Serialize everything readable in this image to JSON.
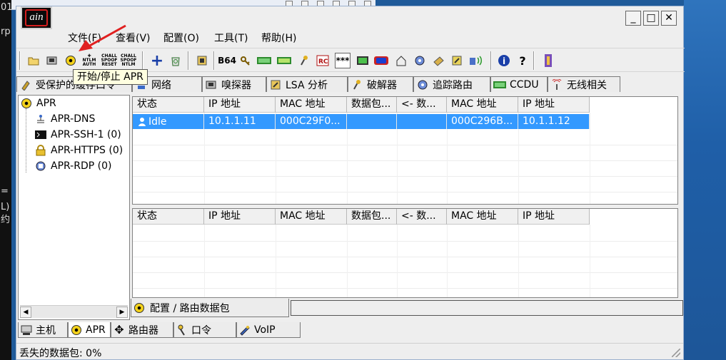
{
  "desktop": {
    "left_glyphs": [
      "01",
      "rp",
      "",
      "",
      "",
      "",
      "",
      "",
      "",
      "",
      "",
      "=",
      "L)",
      "约"
    ]
  },
  "window": {
    "logo_text": "ain",
    "minimize": "_",
    "maximize": "□",
    "close": "✕"
  },
  "menu": {
    "file": "文件(F)",
    "view": "查看(V)",
    "config": "配置(O)",
    "tools": "工具(T)",
    "help": "帮助(H)"
  },
  "toolbar": {
    "tooltip": "开始/停止 APR",
    "b64": "B64",
    "ntlm_auth": "NTLM AUTH",
    "chall_spoof_reset": "CHALL SPOOF RESET",
    "chall_spoof_ntlm": "CHALL SPOOF NTLM",
    "pwd": "***"
  },
  "tabs": [
    {
      "label": "受保护的缓存口令"
    },
    {
      "label": "网络"
    },
    {
      "label": "嗅探器"
    },
    {
      "label": "LSA 分析"
    },
    {
      "label": "破解器"
    },
    {
      "label": "追踪路由"
    },
    {
      "label": "CCDU"
    },
    {
      "label": "无线相关"
    }
  ],
  "tree": {
    "root": "APR",
    "children": [
      "APR-DNS",
      "APR-SSH-1 (0)",
      "APR-HTTPS (0)",
      "APR-RDP (0)"
    ]
  },
  "grid_top": {
    "columns": [
      "状态",
      "IP 地址",
      "MAC 地址",
      "数据包...",
      "<- 数...",
      "MAC 地址",
      "IP 地址"
    ],
    "rows": [
      [
        "Idle",
        "10.1.1.11",
        "000C29F0...",
        "",
        "",
        "000C296B...",
        "10.1.1.12"
      ]
    ]
  },
  "grid_bottom": {
    "columns": [
      "状态",
      "IP 地址",
      "MAC 地址",
      "数据包...",
      "<- 数...",
      "MAC 地址",
      "IP 地址"
    ]
  },
  "routing_bar": {
    "label": "配置 / 路由数据包"
  },
  "bottom_tabs": [
    {
      "label": "主机"
    },
    {
      "label": "APR"
    },
    {
      "label": "路由器"
    },
    {
      "label": "口令"
    },
    {
      "label": "VoIP"
    }
  ],
  "status": {
    "lost_packets": "丢失的数据包:  0%"
  },
  "colors": {
    "selection": "#3399ff",
    "desktop": "#1f5a99",
    "annotation_arrow": "#e02020",
    "tooltip_bg": "#ffffe1"
  }
}
